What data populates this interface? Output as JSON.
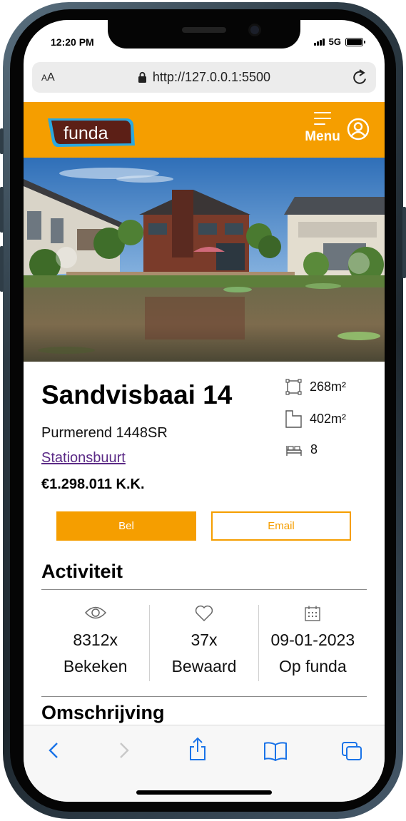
{
  "status_bar": {
    "time": "12:20 PM",
    "network": "5G"
  },
  "browser": {
    "text_size_label": "AA",
    "url": "http://127.0.0.1:5500"
  },
  "header": {
    "brand": "funda",
    "menu_label": "Menu"
  },
  "listing": {
    "title": "Sandvisbaai 14",
    "city": "Purmerend 1448SR",
    "neighborhood": "Stationsbuurt",
    "price": "€1.298.011 K.K.",
    "features": [
      {
        "icon": "living-area-icon",
        "value": "268m²"
      },
      {
        "icon": "plot-area-icon",
        "value": "402m²"
      },
      {
        "icon": "bedroom-icon",
        "value": "8"
      }
    ]
  },
  "actions": {
    "call_label": "Bel",
    "email_label": "Email"
  },
  "activity": {
    "heading": "Activiteit",
    "stats": [
      {
        "icon": "eye-icon",
        "value": "8312x",
        "label": "Bekeken"
      },
      {
        "icon": "heart-icon",
        "value": "37x",
        "label": "Bewaard"
      },
      {
        "icon": "calendar-icon",
        "value": "09-01-2023",
        "label": "Op funda"
      }
    ]
  },
  "description": {
    "heading": "Omschrijving"
  },
  "colors": {
    "brand": "#f59e00",
    "link": "#5b2a86",
    "logo_bg": "#5c1f16",
    "logo_border": "#2aa8e0"
  },
  "toolbar": {
    "items": [
      "back-icon",
      "forward-icon",
      "share-icon",
      "bookmarks-icon",
      "tabs-icon"
    ]
  }
}
